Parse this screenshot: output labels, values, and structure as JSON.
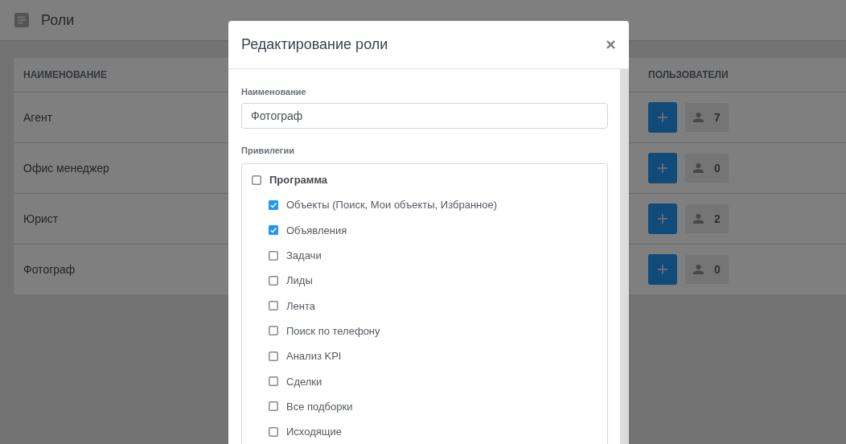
{
  "page": {
    "title": "Роли"
  },
  "table": {
    "columns": [
      "НАИМЕНОВАНИЕ",
      "ПОЛЬЗОВАТЕЛИ"
    ],
    "rows": [
      {
        "name": "Агент",
        "users": "7"
      },
      {
        "name": "Офис менеджер",
        "users": "0"
      },
      {
        "name": "Юрист",
        "users": "2"
      },
      {
        "name": "Фотограф",
        "users": "0"
      }
    ]
  },
  "modal": {
    "title": "Редактирование роли",
    "name_field": {
      "label": "Наименование",
      "value": "Фотограф"
    },
    "privileges": {
      "label": "Привилегии",
      "groups": [
        {
          "label": "Программа",
          "checked": false,
          "children": [
            {
              "label": "Объекты (Поиск, Мои объекты, Избранное)",
              "checked": true
            },
            {
              "label": "Объявления",
              "checked": true
            },
            {
              "label": "Задачи",
              "checked": false
            },
            {
              "label": "Лиды",
              "checked": false
            },
            {
              "label": "Лента",
              "checked": false
            },
            {
              "label": "Поиск по телефону",
              "checked": false
            },
            {
              "label": "Анализ KPI",
              "checked": false
            },
            {
              "label": "Сделки",
              "checked": false
            },
            {
              "label": "Все подборки",
              "checked": false
            },
            {
              "label": "Исходящие",
              "checked": false
            }
          ]
        }
      ]
    }
  }
}
